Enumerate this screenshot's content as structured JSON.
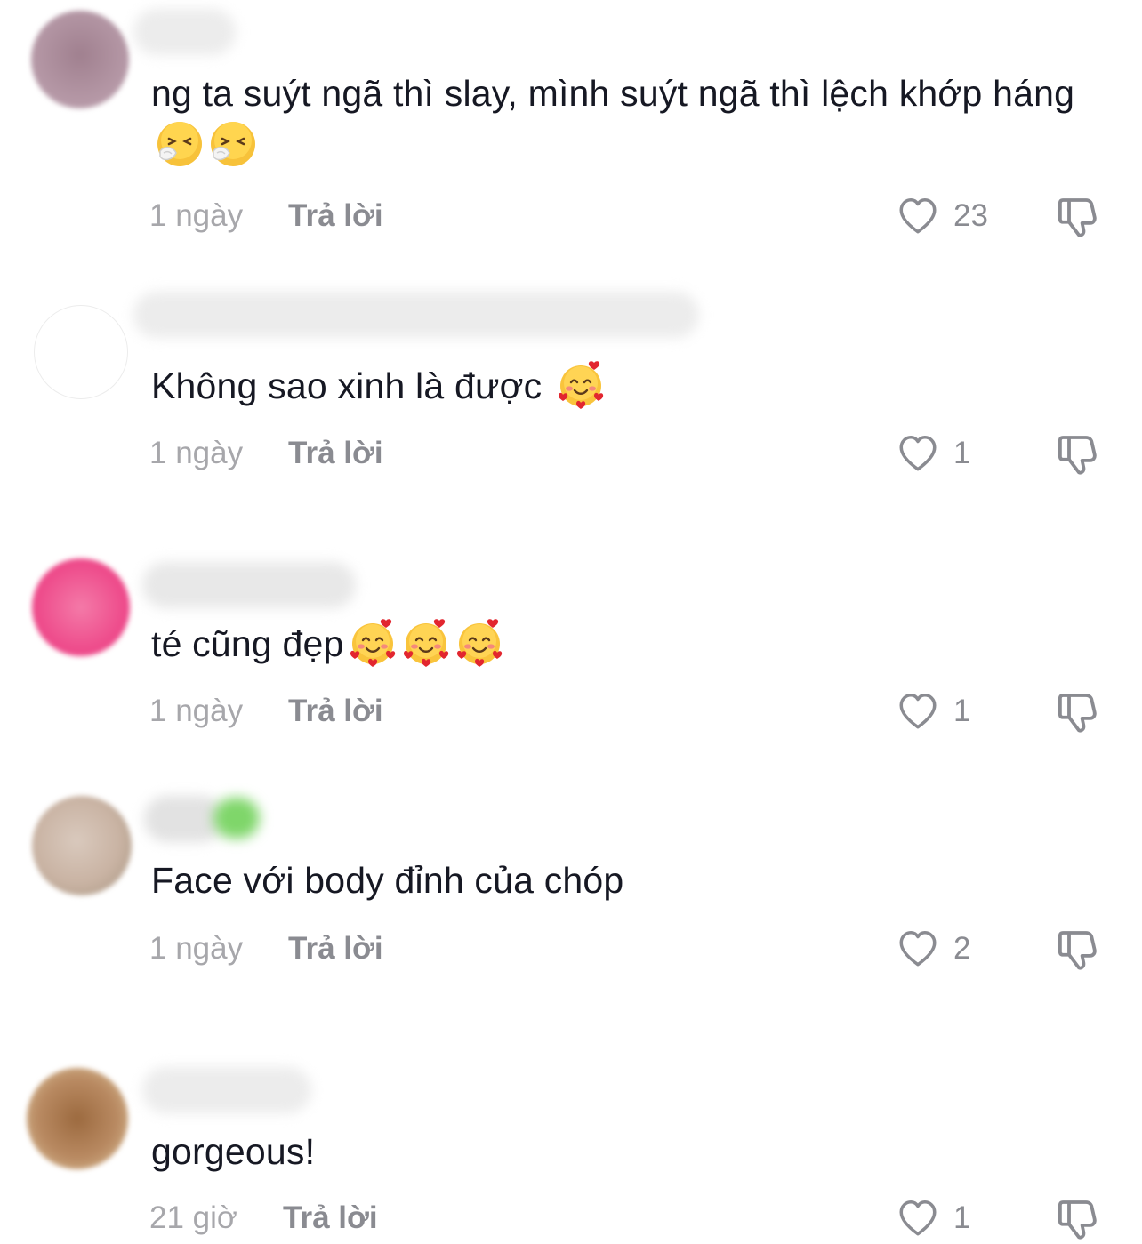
{
  "comments": [
    {
      "text": "ng ta suýt ngã thì slay, mình suýt ngã thì lệch khớp háng",
      "emoji": "sneezing-face-emoji",
      "time": "1 ngày",
      "reply": "Trả lời",
      "likes": "23"
    },
    {
      "text": "Không sao xinh là được",
      "emoji": "smiling-face-with-hearts-emoji",
      "time": "1 ngày",
      "reply": "Trả lời",
      "likes": "1"
    },
    {
      "text": "té cũng đẹp",
      "emoji": "smiling-face-with-hearts-emoji",
      "time": "1 ngày",
      "reply": "Trả lời",
      "likes": "1"
    },
    {
      "text": "Face với body đỉnh của chóp",
      "time": "1 ngày",
      "reply": "Trả lời",
      "likes": "2"
    },
    {
      "text": "gorgeous!",
      "time": "21 giờ",
      "reply": "Trả lời",
      "likes": "1"
    }
  ],
  "colors": {
    "text": "#161823",
    "meta": "#a7a7ab",
    "reply": "#8a8b91",
    "icon": "#8a8b91"
  }
}
